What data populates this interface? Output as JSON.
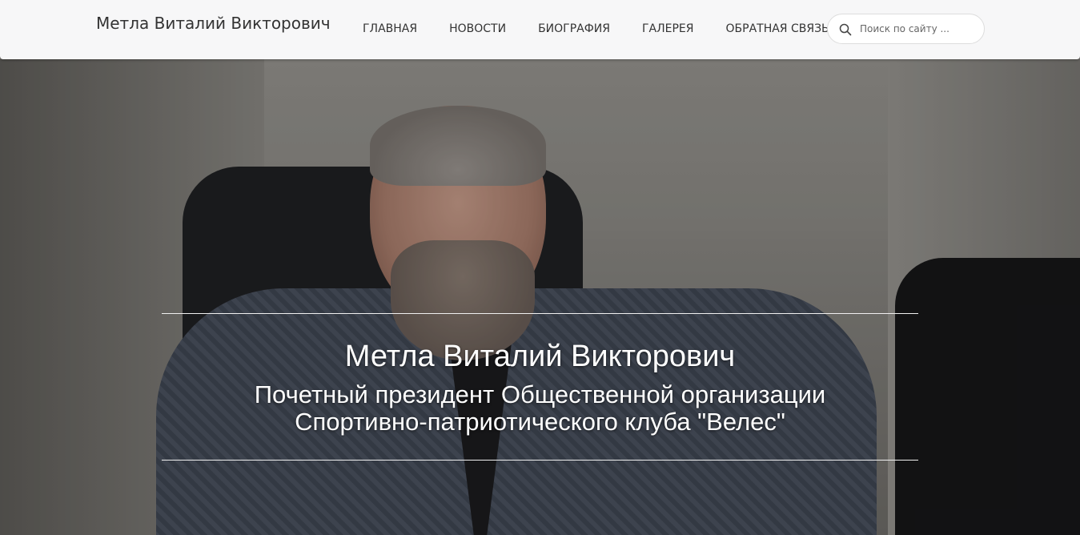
{
  "site": {
    "brand": "Метла Виталий Викторович"
  },
  "nav": {
    "items": [
      {
        "label": "ГЛАВНАЯ"
      },
      {
        "label": "НОВОСТИ"
      },
      {
        "label": "БИОГРАФИЯ"
      },
      {
        "label": "ГАЛЕРЕЯ"
      },
      {
        "label": "ОБРАТНАЯ СВЯЗЬ"
      }
    ]
  },
  "search": {
    "placeholder": "Поиск по сайту ...",
    "icon": "search-icon"
  },
  "hero": {
    "title": "Метла Виталий Викторович",
    "subtitle_line1": "Почетный президент Общественной организации",
    "subtitle_line2": "Спортивно-патриотического клуба \"Велес\""
  },
  "colors": {
    "navbar_bg": "#f7f7f8",
    "text_dark": "#333333",
    "caption_text": "#ffffff"
  }
}
